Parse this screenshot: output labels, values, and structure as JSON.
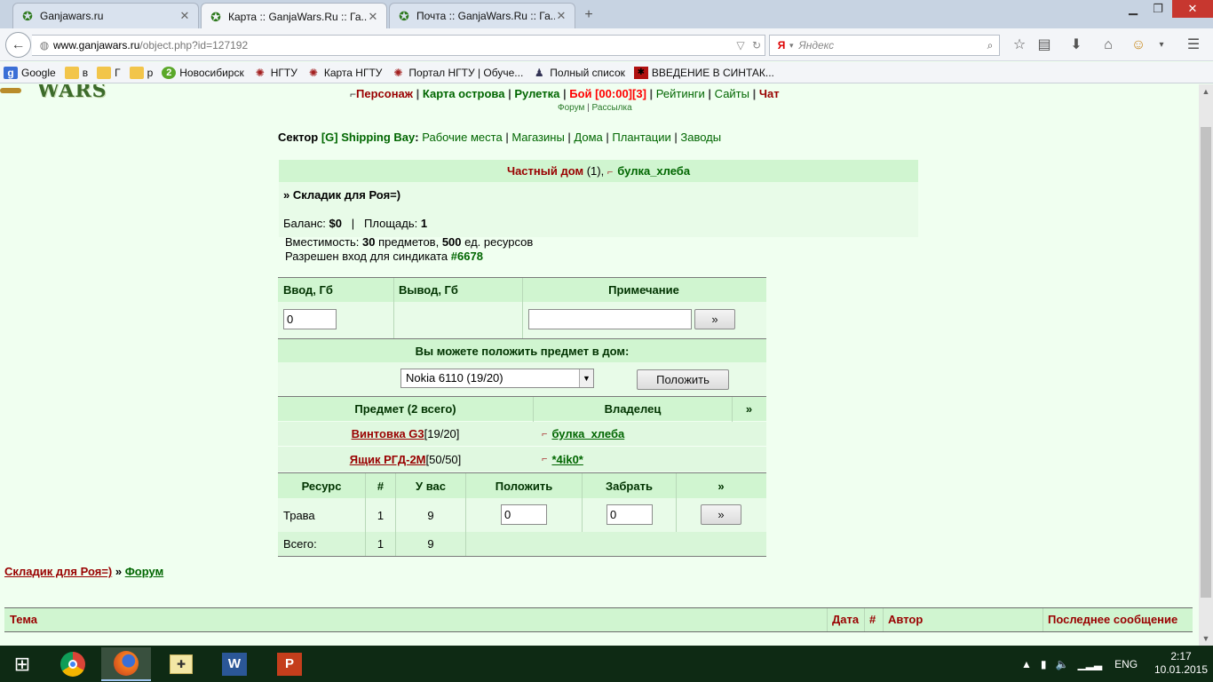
{
  "browser": {
    "tabs": [
      {
        "title": "Ganjawars.ru",
        "active": false
      },
      {
        "title": "Карта :: GanjaWars.Ru :: Га...",
        "active": true
      },
      {
        "title": "Почта :: GanjaWars.Ru :: Га...",
        "active": false
      }
    ],
    "new_tab_symbol": "+",
    "url_host": "www.ganjawars.ru",
    "url_path": "/object.php?id=127192",
    "search_placeholder": "Яндекс",
    "search_engine_glyph": "Я",
    "bookmarks": [
      {
        "label": "Google",
        "icon": "google-icon"
      },
      {
        "label": "в",
        "icon": "folder-icon"
      },
      {
        "label": "Г",
        "icon": "folder-icon"
      },
      {
        "label": "р",
        "icon": "folder-icon"
      },
      {
        "label": "Новосибирск",
        "icon": "green-circle-icon",
        "glyph": "2"
      },
      {
        "label": "НГТУ",
        "icon": "ngtu-icon"
      },
      {
        "label": "Карта НГТУ",
        "icon": "ngtu-icon"
      },
      {
        "label": "Портал НГТУ | Обуче...",
        "icon": "ngtu-icon"
      },
      {
        "label": "Полный список",
        "icon": "people-icon"
      },
      {
        "label": "ВВЕДЕНИЕ В СИНТАК...",
        "icon": "red-square-icon"
      }
    ]
  },
  "site": {
    "logo_text": "WARS",
    "menu": {
      "character": "Персонаж",
      "island_map": "Карта острова",
      "roulette": "Рулетка",
      "battle": "Бой [00:00][3]",
      "ratings": "Рейтинги",
      "sites": "Сайты",
      "chat": "Чат"
    },
    "submenu": {
      "forum": "Форум",
      "mailing": "Рассылка"
    }
  },
  "sector": {
    "prefix": "Сектор ",
    "name": "[G] Shipping Bay",
    "links": [
      "Рабочие места",
      "Магазины",
      "Дома",
      "Плантации",
      "Заводы"
    ]
  },
  "house": {
    "type": "Частный дом",
    "count": " (1), ",
    "owner": "булка_хлеба",
    "storage_name": "» Складик для Роя=)",
    "balance_label": "Баланс: ",
    "balance_value": "$0",
    "area_label": "Площадь: ",
    "area_value": "1",
    "capacity_label": "Вместимость: ",
    "capacity_items": "30",
    "capacity_items_unit": " предметов, ",
    "capacity_res": "500",
    "capacity_res_unit": " ед. ресурсов",
    "syndicate_label": "Разрешен вход для синдиката ",
    "syndicate_id": "#6678"
  },
  "money": {
    "headers": {
      "in": "Ввод, Гб",
      "out": "Вывод, Гб",
      "note": "Примечание"
    },
    "in_value": "0",
    "note_value": "",
    "submit": "»"
  },
  "put_item": {
    "title": "Вы можете положить предмет в дом:",
    "selected": "Nokia 6110 (19/20)",
    "button": "Положить"
  },
  "items": {
    "headers": {
      "item": "Предмет (2 всего)",
      "owner": "Владелец",
      "more": "»"
    },
    "rows": [
      {
        "name": "Винтовка G3",
        "dur": " [19/20]",
        "owner": "булка_хлеба"
      },
      {
        "name": "Ящик РГД-2М",
        "dur": " [50/50]",
        "owner": "*4ik0*"
      }
    ]
  },
  "resources": {
    "headers": {
      "res": "Ресурс",
      "num": "#",
      "have": "У вас",
      "put": "Положить",
      "take": "Забрать",
      "more": "»"
    },
    "rows": [
      {
        "name": "Трава",
        "num": "1",
        "have": "9",
        "put": "0",
        "take": "0",
        "btn": "»"
      }
    ],
    "total": {
      "label": "Всего:",
      "num": "1",
      "have": "9"
    }
  },
  "forum": {
    "breadcrumb_storage": "Складик для Роя=)",
    "breadcrumb_sep": " » ",
    "breadcrumb_forum": "Форум",
    "headers": {
      "topic": "Тема",
      "date": "Дата",
      "num": "#",
      "author": "Автор",
      "last": "Последнее сообщение"
    }
  },
  "taskbar": {
    "lang": "ENG",
    "time": "2:17",
    "date": "10.01.2015"
  }
}
